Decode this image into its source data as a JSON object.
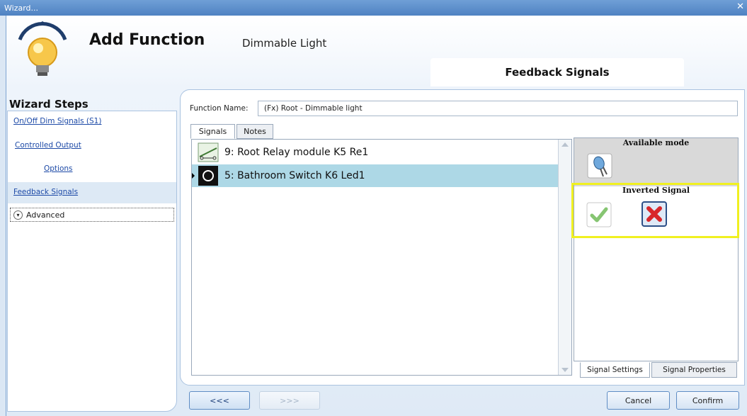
{
  "window": {
    "title": "Wizard...",
    "close_glyph": "✕"
  },
  "header": {
    "title": "Add Function",
    "subtitle": "Dimmable Light",
    "step_title": "Feedback Signals"
  },
  "wizard_steps": {
    "title": "Wizard Steps",
    "items": [
      {
        "label": "On/Off Dim Signals (S1)"
      },
      {
        "label": "Controlled Output"
      },
      {
        "label": "Options"
      },
      {
        "label": "Feedback Signals"
      }
    ],
    "advanced_label": "Advanced"
  },
  "function_name": {
    "label": "Function Name:",
    "value": "(Fx) Root - Dimmable light"
  },
  "tabs": [
    {
      "label": "Signals"
    },
    {
      "label": "Notes"
    }
  ],
  "signals": [
    {
      "label": "9: Root Relay module K5 Re1",
      "icon": "relay-icon"
    },
    {
      "label": "5: Bathroom Switch K6 Led1",
      "icon": "switch-led-icon"
    }
  ],
  "side_panel": {
    "available_mode_title": "Available mode",
    "inverted_signal_title": "Inverted Signal",
    "tabs": [
      {
        "label": "Signal Settings"
      },
      {
        "label": "Signal Properties"
      }
    ]
  },
  "buttons": {
    "back": "<<<",
    "next": ">>>",
    "cancel": "Cancel",
    "confirm": "Confirm"
  },
  "colors": {
    "selection": "#add8e6",
    "highlight": "#f0f020",
    "accent": "#4f82c2"
  }
}
